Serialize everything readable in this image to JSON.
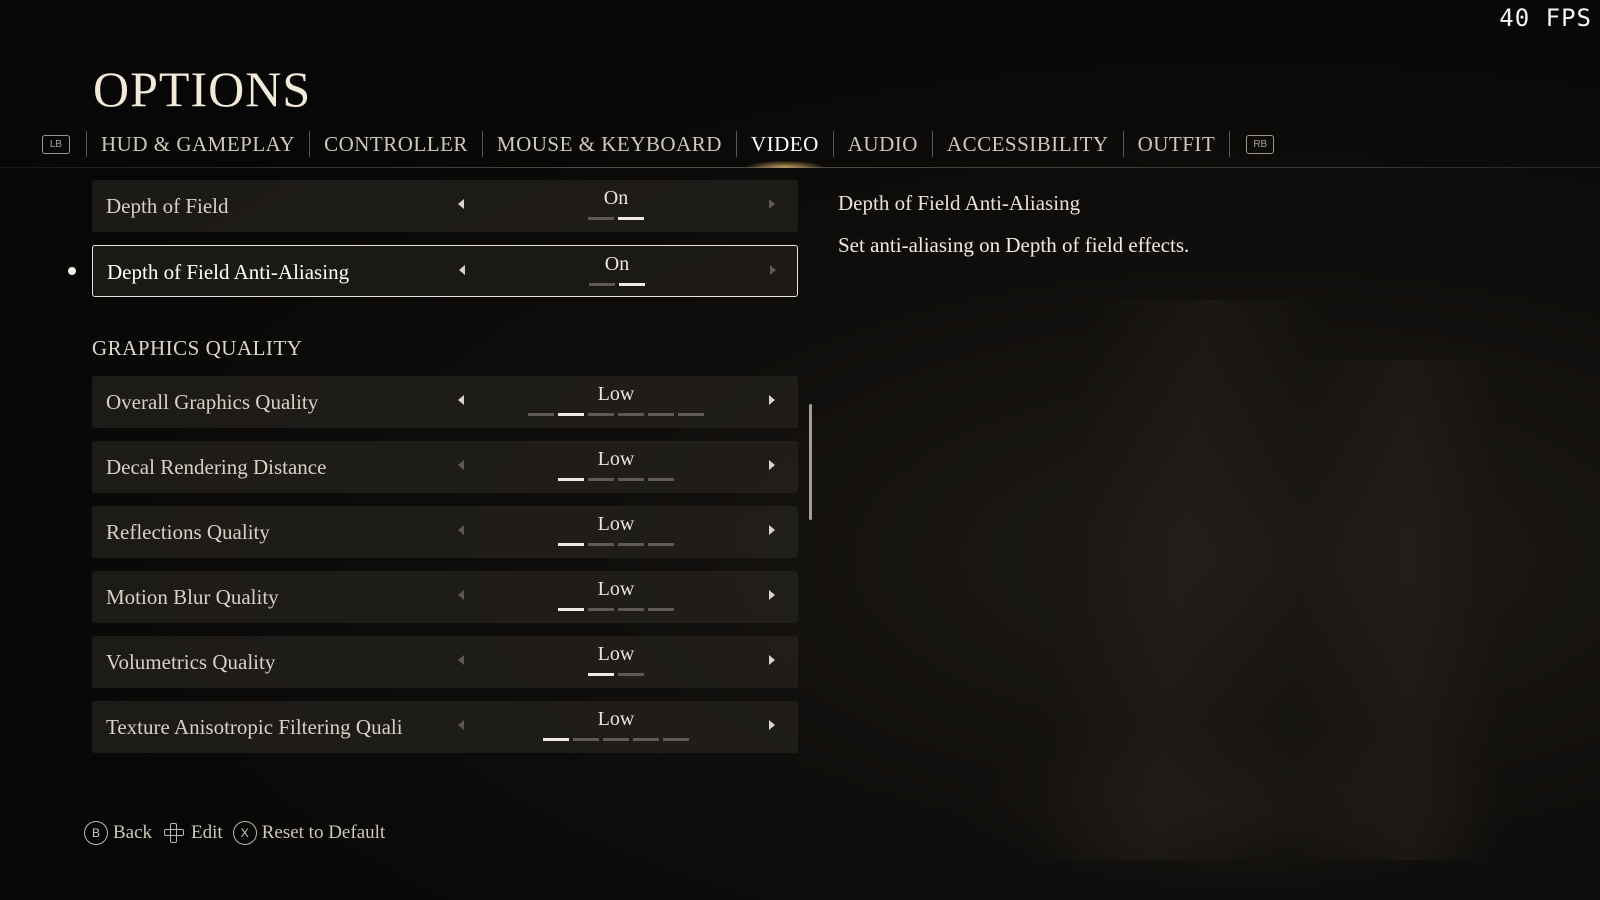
{
  "fps": "40 FPS",
  "title": "OPTIONS",
  "tabs": {
    "left_bumper": "LB",
    "right_bumper": "RB",
    "items": [
      {
        "label": "HUD & GAMEPLAY"
      },
      {
        "label": "CONTROLLER"
      },
      {
        "label": "MOUSE & KEYBOARD"
      },
      {
        "label": "VIDEO",
        "active": true
      },
      {
        "label": "AUDIO"
      },
      {
        "label": "ACCESSIBILITY"
      },
      {
        "label": "OUTFIT"
      }
    ]
  },
  "settings_top": [
    {
      "label": "Depth of Field",
      "value": "On",
      "options": 2,
      "selected_index": 1
    },
    {
      "label": "Depth of Field Anti-Aliasing",
      "value": "On",
      "options": 2,
      "selected_index": 1,
      "focused": true
    }
  ],
  "section_heading": "GRAPHICS QUALITY",
  "settings_graphics": [
    {
      "label": "Overall Graphics Quality",
      "value": "Low",
      "options": 6,
      "selected_index": 1
    },
    {
      "label": "Decal Rendering Distance",
      "value": "Low",
      "options": 4,
      "selected_index": 0
    },
    {
      "label": "Reflections Quality",
      "value": "Low",
      "options": 4,
      "selected_index": 0
    },
    {
      "label": "Motion Blur Quality",
      "value": "Low",
      "options": 4,
      "selected_index": 0
    },
    {
      "label": "Volumetrics Quality",
      "value": "Low",
      "options": 2,
      "selected_index": 0
    },
    {
      "label": "Texture Anisotropic Filtering Quali",
      "value": "Low",
      "options": 5,
      "selected_index": 0
    }
  ],
  "description": {
    "title": "Depth of Field Anti-Aliasing",
    "body": "Set anti-aliasing on Depth of field effects."
  },
  "footer": {
    "back_key": "B",
    "back_label": "Back",
    "edit_label": "Edit",
    "reset_key": "X",
    "reset_label": "Reset to Default"
  }
}
